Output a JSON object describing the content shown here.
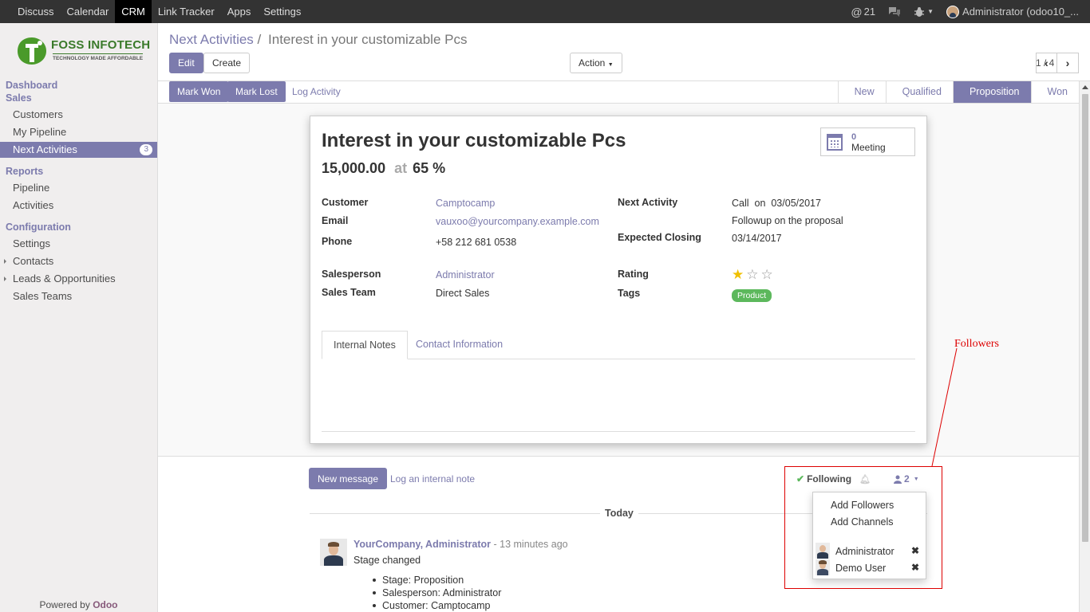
{
  "topbar": {
    "menu": [
      "Discuss",
      "Calendar",
      "CRM",
      "Link Tracker",
      "Apps",
      "Settings"
    ],
    "active": "CRM",
    "mentions_count": "21",
    "user_label": "Administrator (odoo10_..."
  },
  "logo": {
    "name": "FOSS INFOTECH",
    "tagline": "TECHNOLOGY MADE AFFORDABLE"
  },
  "sidebar": {
    "dashboard": "Dashboard",
    "sales": "Sales",
    "customers": "Customers",
    "my_pipeline": "My Pipeline",
    "next_activities": "Next Activities",
    "next_activities_count": "3",
    "reports": "Reports",
    "pipeline": "Pipeline",
    "activities": "Activities",
    "configuration": "Configuration",
    "settings": "Settings",
    "contacts": "Contacts",
    "leads": "Leads & Opportunities",
    "sales_teams": "Sales Teams",
    "powered_prefix": "Powered by",
    "powered_brand": "Odoo"
  },
  "control": {
    "breadcrumb_parent": "Next Activities",
    "breadcrumb_sep": "/",
    "breadcrumb_current": "Interest in your customizable Pcs",
    "edit": "Edit",
    "create": "Create",
    "action": "Action",
    "pager": "1 / 4"
  },
  "statusbar": {
    "mark_won": "Mark Won",
    "mark_lost": "Mark Lost",
    "log_activity": "Log Activity",
    "stages": [
      "New",
      "Qualified",
      "Proposition",
      "Won"
    ],
    "current_stage": "Proposition"
  },
  "record": {
    "title": "Interest in your customizable Pcs",
    "revenue": "15,000.00",
    "at": "at",
    "probability": "65 %",
    "meeting_count": "0",
    "meeting_label": "Meeting",
    "customer_label": "Customer",
    "customer": "Camptocamp",
    "email_label": "Email",
    "email": "vauxoo@yourcompany.example.com",
    "phone_label": "Phone",
    "phone": "+58 212 681 0538",
    "next_activity_label": "Next Activity",
    "next_activity": "Call",
    "on": "on",
    "next_activity_date": "03/05/2017",
    "next_activity_summary": "Followup on the proposal",
    "expected_closing_label": "Expected Closing",
    "expected_closing": "03/14/2017",
    "salesperson_label": "Salesperson",
    "salesperson": "Administrator",
    "sales_team_label": "Sales Team",
    "sales_team": "Direct Sales",
    "rating_label": "Rating",
    "rating": 1,
    "rating_max": 3,
    "tags_label": "Tags",
    "tag": "Product",
    "tabs": [
      "Internal Notes",
      "Contact Information"
    ]
  },
  "chatter": {
    "new_message": "New message",
    "log_note": "Log an internal note",
    "following": "Following",
    "followers_count": "2",
    "today": "Today",
    "author": "YourCompany, Administrator",
    "time": "- 13 minutes ago",
    "body": "Stage changed",
    "changes": [
      "Stage: Proposition",
      "Salesperson: Administrator",
      "Customer: Camptocamp"
    ],
    "add_followers": "Add Followers",
    "add_channels": "Add Channels",
    "followers": [
      "Administrator",
      "Demo User"
    ]
  },
  "annotation": {
    "label": "Followers"
  },
  "colors": {
    "primary": "#7c7bad",
    "topbar": "#333333",
    "tag": "#5cb85c",
    "annotation": "#dd0000",
    "star": "#f0c000"
  }
}
